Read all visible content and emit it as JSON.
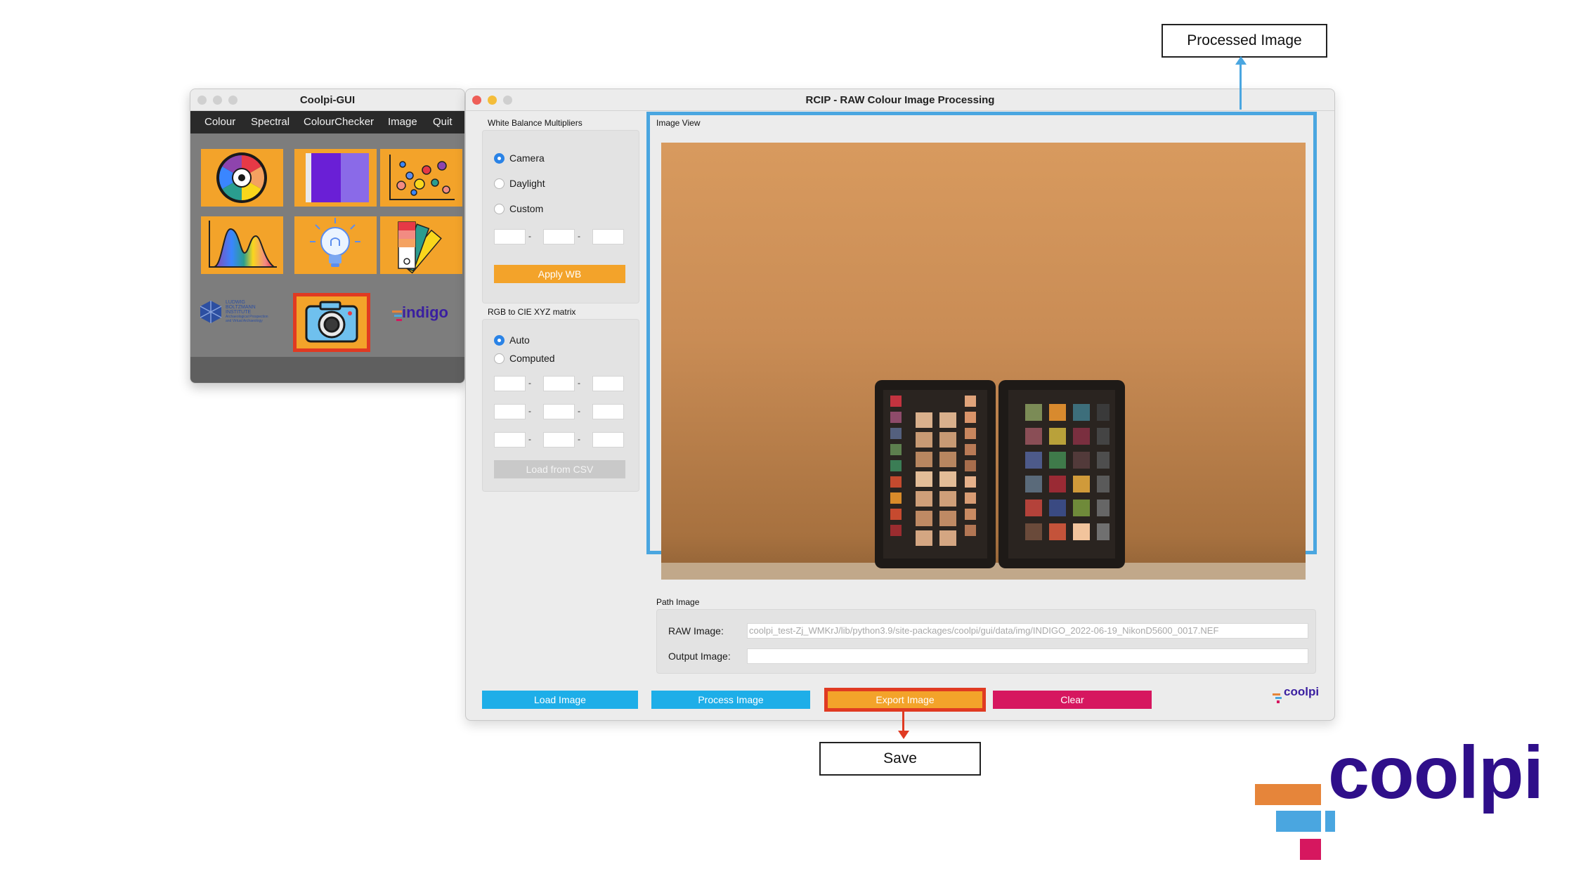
{
  "coolpi_gui": {
    "title": "Coolpi-GUI",
    "menu": [
      "Colour",
      "Spectral",
      "ColourChecker",
      "Image",
      "Quit"
    ],
    "tiles": [
      {
        "name": "colour-wheel-icon"
      },
      {
        "name": "spectral-bars-icon"
      },
      {
        "name": "scatter-plot-icon"
      },
      {
        "name": "spectrum-chart-icon"
      },
      {
        "name": "light-bulb-icon"
      },
      {
        "name": "colour-swatch-fan-icon"
      },
      {
        "name": "camera-icon",
        "selected": true
      }
    ],
    "logos": {
      "lbi_lines": [
        "LUDWIG",
        "BOLTZMANN",
        "INSTITUTE",
        "Archaeological Prospection",
        "and Virtual Archaeology"
      ],
      "indigo": "indigo"
    }
  },
  "rcip": {
    "title": "RCIP - RAW Colour Image Processing",
    "white_balance": {
      "label": "White Balance Multipliers",
      "options": [
        "Camera",
        "Daylight",
        "Custom"
      ],
      "selected": "Camera",
      "apply_button": "Apply WB"
    },
    "matrix": {
      "label": "RGB to CIE XYZ matrix",
      "options": [
        "Auto",
        "Computed"
      ],
      "selected": "Auto",
      "load_button": "Load from CSV"
    },
    "image_view": {
      "label": "Image View"
    },
    "path_image": {
      "label": "Path Image",
      "raw_label": "RAW Image:",
      "raw_value": "coolpi_test-Zj_WMKrJ/lib/python3.9/site-packages/coolpi/gui/data/img/INDIGO_2022-06-19_NikonD5600_0017.NEF",
      "output_label": "Output Image:",
      "output_value": ""
    },
    "buttons": {
      "load": "Load Image",
      "process": "Process Image",
      "export": "Export Image",
      "clear": "Clear"
    },
    "logo_small": "coolpi"
  },
  "annotations": {
    "processed": "Processed Image",
    "save": "Save"
  },
  "brand_logo": "coolpi",
  "colors": {
    "orange": "#f3a32a",
    "blue_button": "#1eaee8",
    "export_button": "#f3a32a",
    "clear_button": "#d6175f",
    "highlight_blue": "#4aa6e0",
    "highlight_red": "#e03a22",
    "brand_purple": "#2f0f8a"
  }
}
